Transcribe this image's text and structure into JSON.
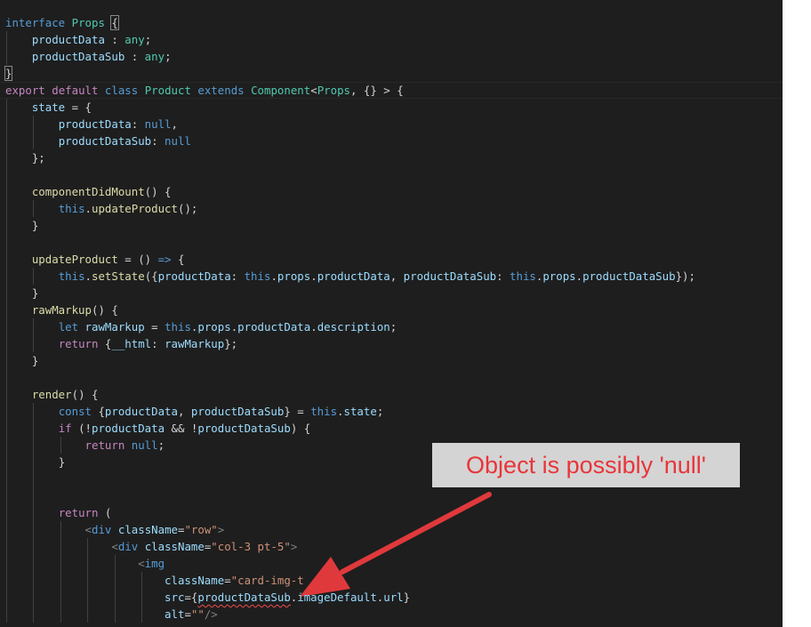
{
  "editor": {
    "background": "#1e1e1e",
    "lines": [
      {
        "indent": 0,
        "tokens": [
          [
            "kw",
            "interface"
          ],
          [
            "ws",
            " "
          ],
          [
            "cls",
            "Props"
          ],
          [
            "ws",
            " "
          ],
          [
            "bracket",
            "{"
          ]
        ]
      },
      {
        "indent": 1,
        "tokens": [
          [
            "var",
            "productData"
          ],
          [
            "pun",
            " : "
          ],
          [
            "cls",
            "any"
          ],
          [
            "pun",
            ";"
          ]
        ]
      },
      {
        "indent": 1,
        "tokens": [
          [
            "var",
            "productDataSub"
          ],
          [
            "pun",
            " : "
          ],
          [
            "cls",
            "any"
          ],
          [
            "pun",
            ";"
          ]
        ]
      },
      {
        "indent": 0,
        "tokens": [
          [
            "bracket",
            "}"
          ]
        ]
      },
      {
        "indent": 0,
        "tokens": [
          [
            "ctl",
            "export"
          ],
          [
            "ws",
            " "
          ],
          [
            "ctl",
            "default"
          ],
          [
            "ws",
            " "
          ],
          [
            "kw",
            "class"
          ],
          [
            "ws",
            " "
          ],
          [
            "cls",
            "Product"
          ],
          [
            "ws",
            " "
          ],
          [
            "kw",
            "extends"
          ],
          [
            "ws",
            " "
          ],
          [
            "cls",
            "Component"
          ],
          [
            "pun",
            "<"
          ],
          [
            "cls",
            "Props"
          ],
          [
            "pun",
            ", {} > {"
          ]
        ]
      },
      {
        "indent": 1,
        "tokens": [
          [
            "var",
            "state"
          ],
          [
            "pun",
            " = {"
          ]
        ]
      },
      {
        "indent": 2,
        "tokens": [
          [
            "var",
            "productData"
          ],
          [
            "pun",
            ": "
          ],
          [
            "kw",
            "null"
          ],
          [
            "pun",
            ","
          ]
        ]
      },
      {
        "indent": 2,
        "tokens": [
          [
            "var",
            "productDataSub"
          ],
          [
            "pun",
            ": "
          ],
          [
            "kw",
            "null"
          ]
        ]
      },
      {
        "indent": 1,
        "tokens": [
          [
            "pun",
            "};"
          ]
        ]
      },
      {
        "indent": 1,
        "tokens": []
      },
      {
        "indent": 1,
        "tokens": [
          [
            "fn",
            "componentDidMount"
          ],
          [
            "pun",
            "() {"
          ]
        ]
      },
      {
        "indent": 2,
        "tokens": [
          [
            "kw",
            "this"
          ],
          [
            "pun",
            "."
          ],
          [
            "fn",
            "updateProduct"
          ],
          [
            "pun",
            "();"
          ]
        ]
      },
      {
        "indent": 1,
        "tokens": [
          [
            "pun",
            "}"
          ]
        ]
      },
      {
        "indent": 1,
        "tokens": []
      },
      {
        "indent": 1,
        "tokens": [
          [
            "fn",
            "updateProduct"
          ],
          [
            "pun",
            " = () "
          ],
          [
            "kw",
            "=>"
          ],
          [
            "pun",
            " {"
          ]
        ]
      },
      {
        "indent": 2,
        "tokens": [
          [
            "kw",
            "this"
          ],
          [
            "pun",
            "."
          ],
          [
            "fn",
            "setState"
          ],
          [
            "pun",
            "({"
          ],
          [
            "var",
            "productData"
          ],
          [
            "pun",
            ": "
          ],
          [
            "kw",
            "this"
          ],
          [
            "pun",
            "."
          ],
          [
            "var",
            "props"
          ],
          [
            "pun",
            "."
          ],
          [
            "var",
            "productData"
          ],
          [
            "pun",
            ", "
          ],
          [
            "var",
            "productDataSub"
          ],
          [
            "pun",
            ": "
          ],
          [
            "kw",
            "this"
          ],
          [
            "pun",
            "."
          ],
          [
            "var",
            "props"
          ],
          [
            "pun",
            "."
          ],
          [
            "var",
            "productDataSub"
          ],
          [
            "pun",
            "});"
          ]
        ]
      },
      {
        "indent": 1,
        "tokens": [
          [
            "pun",
            "}"
          ]
        ]
      },
      {
        "indent": 1,
        "tokens": [
          [
            "fn",
            "rawMarkup"
          ],
          [
            "pun",
            "() {"
          ]
        ]
      },
      {
        "indent": 2,
        "tokens": [
          [
            "kw",
            "let"
          ],
          [
            "ws",
            " "
          ],
          [
            "var",
            "rawMarkup"
          ],
          [
            "pun",
            " = "
          ],
          [
            "kw",
            "this"
          ],
          [
            "pun",
            "."
          ],
          [
            "var",
            "props"
          ],
          [
            "pun",
            "."
          ],
          [
            "var",
            "productData"
          ],
          [
            "pun",
            "."
          ],
          [
            "var",
            "description"
          ],
          [
            "pun",
            ";"
          ]
        ]
      },
      {
        "indent": 2,
        "tokens": [
          [
            "ctl",
            "return"
          ],
          [
            "pun",
            " {"
          ],
          [
            "var",
            "__html"
          ],
          [
            "pun",
            ": "
          ],
          [
            "var",
            "rawMarkup"
          ],
          [
            "pun",
            "};"
          ]
        ]
      },
      {
        "indent": 1,
        "tokens": [
          [
            "pun",
            "}"
          ]
        ]
      },
      {
        "indent": 1,
        "tokens": []
      },
      {
        "indent": 1,
        "tokens": [
          [
            "fn",
            "render"
          ],
          [
            "pun",
            "() {"
          ]
        ]
      },
      {
        "indent": 2,
        "tokens": [
          [
            "kw",
            "const"
          ],
          [
            "pun",
            " {"
          ],
          [
            "var",
            "productData"
          ],
          [
            "pun",
            ", "
          ],
          [
            "var",
            "productDataSub"
          ],
          [
            "pun",
            "} = "
          ],
          [
            "kw",
            "this"
          ],
          [
            "pun",
            "."
          ],
          [
            "var",
            "state"
          ],
          [
            "pun",
            ";"
          ]
        ]
      },
      {
        "indent": 2,
        "tokens": [
          [
            "ctl",
            "if"
          ],
          [
            "pun",
            " (!"
          ],
          [
            "var",
            "productData"
          ],
          [
            "pun",
            " && !"
          ],
          [
            "var",
            "productDataSub"
          ],
          [
            "pun",
            ") {"
          ]
        ]
      },
      {
        "indent": 3,
        "tokens": [
          [
            "ctl",
            "return"
          ],
          [
            "ws",
            " "
          ],
          [
            "kw",
            "null"
          ],
          [
            "pun",
            ";"
          ]
        ]
      },
      {
        "indent": 2,
        "tokens": [
          [
            "pun",
            "}"
          ]
        ]
      },
      {
        "indent": 2,
        "tokens": []
      },
      {
        "indent": 2,
        "tokens": []
      },
      {
        "indent": 2,
        "tokens": [
          [
            "ctl",
            "return"
          ],
          [
            "pun",
            " ("
          ]
        ]
      },
      {
        "indent": 3,
        "tokens": [
          [
            "tagp",
            "<"
          ],
          [
            "tag",
            "div"
          ],
          [
            "ws",
            " "
          ],
          [
            "var",
            "className"
          ],
          [
            "pun",
            "="
          ],
          [
            "str",
            "\"row\""
          ],
          [
            "tagp",
            ">"
          ]
        ]
      },
      {
        "indent": 4,
        "tokens": [
          [
            "tagp",
            "<"
          ],
          [
            "tag",
            "div"
          ],
          [
            "ws",
            " "
          ],
          [
            "var",
            "className"
          ],
          [
            "pun",
            "="
          ],
          [
            "str",
            "\"col-3 pt-5\""
          ],
          [
            "tagp",
            ">"
          ]
        ]
      },
      {
        "indent": 5,
        "tokens": [
          [
            "tagp",
            "<"
          ],
          [
            "tag",
            "img"
          ]
        ]
      },
      {
        "indent": 6,
        "tokens": [
          [
            "var",
            "className"
          ],
          [
            "pun",
            "="
          ],
          [
            "str",
            "\"card-img-t"
          ]
        ]
      },
      {
        "indent": 6,
        "tokens": [
          [
            "var",
            "src"
          ],
          [
            "pun",
            "={"
          ],
          [
            "squiggle",
            "productDataSub"
          ],
          [
            "pun",
            "."
          ],
          [
            "var",
            "imageDefault"
          ],
          [
            "pun",
            "."
          ],
          [
            "var",
            "url"
          ],
          [
            "pun",
            "}"
          ]
        ]
      },
      {
        "indent": 6,
        "tokens": [
          [
            "var",
            "alt"
          ],
          [
            "pun",
            "="
          ],
          [
            "str",
            "\"\""
          ],
          [
            "tagp",
            "/>"
          ]
        ]
      }
    ]
  },
  "annotation": {
    "text": "Object is possibly 'null'",
    "color": "#e8353a",
    "background": "#d4d4d4",
    "arrow_color": "#e0393c"
  }
}
